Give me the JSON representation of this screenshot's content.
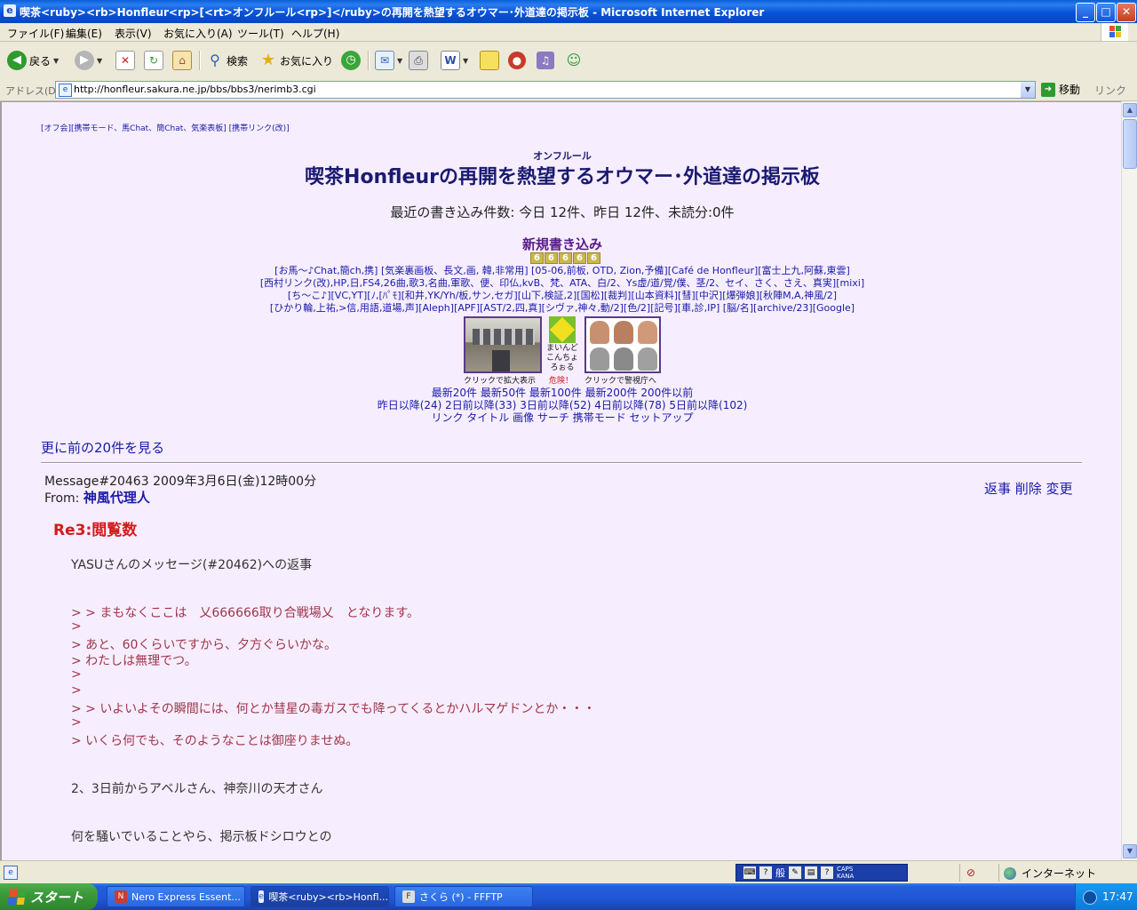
{
  "window": {
    "title": "喫茶<ruby><rb>Honfleur<rp>[<rt>オンフルール<rp>]</ruby>の再開を熱望するオウマー･外道達の掲示板 - Microsoft Internet Explorer",
    "minimize": "_",
    "maximize": "□",
    "close": "✕"
  },
  "menu": [
    "ファイル(F)",
    "編集(E)",
    "表示(V)",
    "お気に入り(A)",
    "ツール(T)",
    "ヘルプ(H)"
  ],
  "toolbar": {
    "back": "戻る",
    "search": "検索",
    "favorites": "お気に入り"
  },
  "address": {
    "label": "アドレス(D)",
    "url": "http://honfleur.sakura.ne.jp/bbs/bbs3/nerimb3.cgi",
    "go": "移動",
    "links": "リンク"
  },
  "page": {
    "top_links": "[オフ会][携帯モード、馬Chat、簡Chat、気楽表板] [携帯リンク(改)]",
    "ruby": "オンフルール",
    "title": "喫茶Honfleurの再開を熱望するオウマー･外道達の掲示板",
    "stats": "最近の書き込み件数: 今日 12件、昨日 12件、未読分:0件",
    "new_post": "新規書き込み",
    "counter": [
      "6",
      "6",
      "6",
      "6",
      "6"
    ],
    "nav_rows": [
      "[お馬～♪Chat,簡ch,携] [気楽裏画板、長文,画, 韓,非常用] [05-06,前板, OTD, Zion,予備][Café de Honfleur][富士上九,阿蘇,東雲]",
      "[西村リンク(改),HP,日,FS4,26曲,歌3,名曲,軍歌、便、印仏,kvB、梵、ATA、白/2、Ys虚/道/覚/僕、茎/2、セイ、さく、さえ、真実][mixi]",
      "[ち～こ♪][VC,YT][ﾉ,[ﾊﾟﾓ][和井,YK/Yh/板,サン,セガ][山下,検証,2][国松][裁判][山本資料][彗][中沢][爆弾娘][秋陣M,A,神風/2]",
      "[ひかり輪,上祐,>信,用語,道場,声][Aleph][APF][AST/2,四,真][シヴァ,神々,動/2][色/2][記号][車,診,IP] [脳/名][archive/23][Google]"
    ],
    "img_caption_left": "クリックで拡大表示",
    "img_caption_mid": "まいんど こんちょ ろぉる",
    "img_caption_danger": "危険！",
    "img_caption_right": "クリックで警視庁へ",
    "recent_links": "最新20件 最新50件 最新100件 最新200件 200件以前",
    "since_links": "昨日以降(24) 2日前以降(33) 3日前以降(52) 4日前以降(78) 5日前以降(102)",
    "tool_links": "リンク タイトル 画像 サーチ 携帯モード セットアップ",
    "prev20": "更に前の20件を見る"
  },
  "message": {
    "header": "Message#20463 2009年3月6日(金)12時00分",
    "from_label": "From:",
    "from_name": "神風代理人",
    "actions": "返事 削除 変更",
    "subject": "Re3:閲覧数",
    "reply_to": "YASUさんのメッセージ(#20462)への返事",
    "lines": [
      "> > まもなくここは　乂666666取り合戦場乂　となります。",
      ">",
      "> あと、60くらいですから、夕方ぐらいかな。",
      "> わたしは無理でつ。",
      ">",
      ">",
      "> > いよいよその瞬間には、何とか彗星の毒ガスでも降ってくるとかハルマゲドンとか・・・",
      ">",
      "> いくら何でも、そのようなことは御座りませぬ。"
    ],
    "para1": "2、3日前からアベルさん、神奈川の天才さん",
    "para2": "何を騒いでいることやら、掲示板ドシロウとの"
  },
  "status": {
    "zone": "インターネット",
    "ime_mode": "般",
    "caps": "CAPS",
    "kana": "KANA"
  },
  "taskbar": {
    "start": "スタート",
    "tasks": [
      "Nero Express Essent...",
      "喫茶<ruby><rb>Honfl...",
      "さくら (*) - FFFTP"
    ],
    "clock": "17:47"
  },
  "colors": {
    "title_bar": "#0653d8",
    "page_bg": "#f6eefe",
    "link": "#1a1aa8",
    "subject": "#d21a1a",
    "quote": "#a0354a"
  }
}
